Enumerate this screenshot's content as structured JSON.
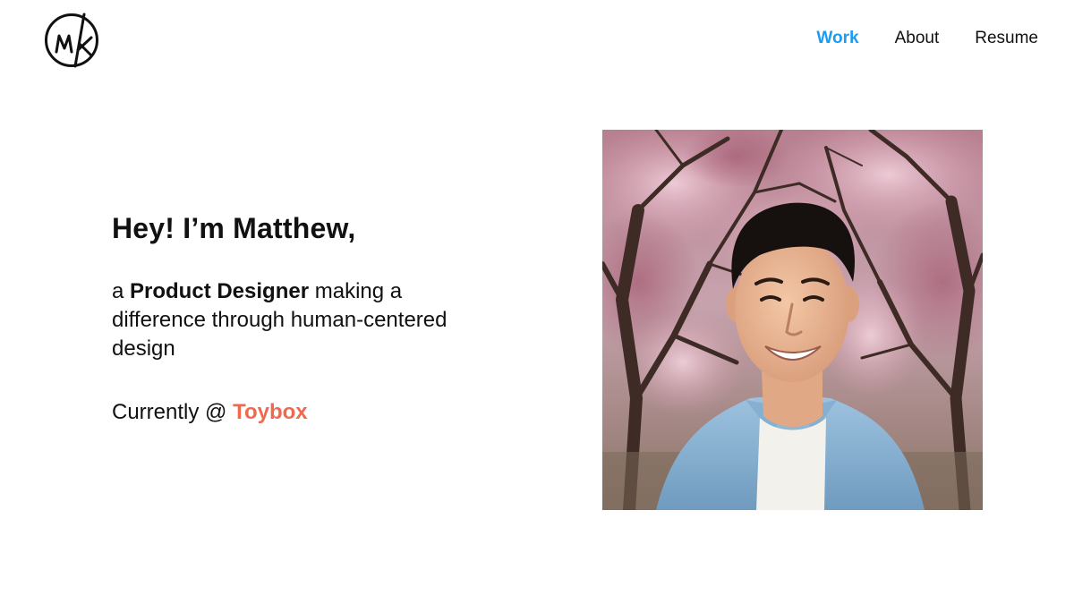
{
  "nav": {
    "logo_alt": "MK",
    "items": [
      {
        "label": "Work",
        "active": true
      },
      {
        "label": "About",
        "active": false
      },
      {
        "label": "Resume",
        "active": false
      }
    ]
  },
  "hero": {
    "greeting": "Hey! I’m Matthew,",
    "tagline_prefix": "a ",
    "role": "Product Designer",
    "tagline_suffix": " making a difference through human-centered design",
    "currently_prefix": "Currently @ ",
    "company": "Toybox"
  },
  "colors": {
    "active_link": "#1d9bf0",
    "company_accent": "#f0694f"
  },
  "icons": {
    "logo": "mk-monogram-logo"
  }
}
